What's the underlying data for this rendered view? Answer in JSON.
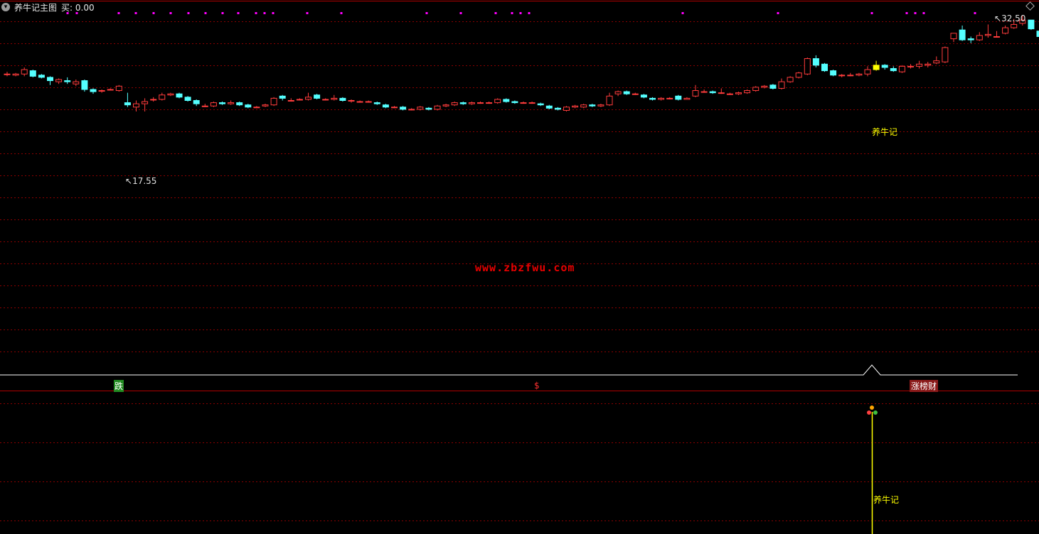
{
  "header": {
    "menu_icon": "chevron-down-icon",
    "title": "养牛记主图",
    "buy_label": "买: 0.00"
  },
  "price_labels": {
    "high": "32.50",
    "low": "17.55",
    "signal": "养牛记"
  },
  "watermark": "www.zbzfwu.com",
  "strip_labels": {
    "left": "跌",
    "mid": "$",
    "right": "涨榜财"
  },
  "lower_pane": {
    "signal_label": "养牛记"
  },
  "colors": {
    "background": "#000000",
    "up": "#ff3c3c",
    "down": "#54ffff",
    "grid": "#8b0000",
    "marker": "#ff00ff",
    "signal": "#ffff00",
    "strip_line": "#ffffff"
  },
  "chart_data": {
    "type": "candlestick",
    "y_high": 32.5,
    "y_low": 17.55,
    "candles": [
      [
        27.2,
        27.2,
        27.4,
        27.0
      ],
      [
        27.1,
        27.2,
        27.3,
        27.0
      ],
      [
        27.2,
        27.6,
        27.8,
        27.0
      ],
      [
        27.5,
        27.0,
        27.6,
        26.9
      ],
      [
        27.1,
        26.9,
        27.2,
        26.8
      ],
      [
        26.9,
        26.6,
        27.0,
        26.2
      ],
      [
        26.5,
        26.7,
        26.8,
        26.3
      ],
      [
        26.6,
        26.5,
        26.9,
        26.3
      ],
      [
        26.3,
        26.5,
        26.7,
        26.1
      ],
      [
        26.6,
        25.8,
        26.7,
        25.6
      ],
      [
        25.8,
        25.6,
        25.9,
        25.4
      ],
      [
        25.7,
        25.7,
        25.8,
        25.5
      ],
      [
        25.8,
        25.8,
        25.9,
        25.7
      ],
      [
        25.7,
        26.1,
        26.2,
        25.6
      ],
      [
        24.6,
        24.4,
        25.5,
        24.2
      ],
      [
        24.2,
        24.5,
        24.8,
        23.8
      ],
      [
        24.5,
        24.7,
        25.0,
        23.8
      ],
      [
        24.9,
        24.9,
        25.1,
        24.7
      ],
      [
        24.9,
        25.3,
        25.5,
        24.8
      ],
      [
        25.3,
        25.4,
        25.5,
        25.2
      ],
      [
        25.4,
        25.1,
        25.5,
        25.0
      ],
      [
        25.1,
        24.8,
        25.2,
        24.7
      ],
      [
        24.8,
        24.5,
        24.9,
        24.3
      ],
      [
        24.3,
        24.3,
        24.5,
        24.2
      ],
      [
        24.3,
        24.6,
        24.7,
        24.2
      ],
      [
        24.6,
        24.5,
        24.7,
        24.4
      ],
      [
        24.5,
        24.6,
        24.8,
        24.4
      ],
      [
        24.6,
        24.4,
        24.7,
        24.3
      ],
      [
        24.4,
        24.2,
        24.5,
        24.1
      ],
      [
        24.2,
        24.2,
        24.3,
        24.1
      ],
      [
        24.3,
        24.4,
        24.5,
        24.2
      ],
      [
        24.4,
        25.0,
        25.1,
        24.3
      ],
      [
        25.2,
        25.0,
        25.3,
        24.8
      ],
      [
        24.8,
        24.8,
        25.0,
        24.7
      ],
      [
        24.9,
        24.9,
        25.0,
        24.8
      ],
      [
        24.9,
        25.1,
        25.5,
        24.8
      ],
      [
        25.3,
        25.0,
        25.4,
        24.9
      ],
      [
        24.9,
        24.9,
        25.0,
        24.8
      ],
      [
        24.9,
        25.0,
        25.3,
        24.8
      ],
      [
        25.0,
        24.8,
        25.1,
        24.7
      ],
      [
        24.8,
        24.8,
        24.9,
        24.6
      ],
      [
        24.7,
        24.7,
        24.8,
        24.6
      ],
      [
        24.7,
        24.7,
        24.8,
        24.6
      ],
      [
        24.6,
        24.5,
        24.7,
        24.4
      ],
      [
        24.4,
        24.2,
        24.5,
        24.1
      ],
      [
        24.2,
        24.2,
        24.3,
        24.1
      ],
      [
        24.2,
        24.0,
        24.3,
        23.9
      ],
      [
        24.0,
        24.0,
        24.1,
        23.9
      ],
      [
        24.0,
        24.2,
        24.3,
        23.9
      ],
      [
        24.1,
        24.0,
        24.2,
        23.9
      ],
      [
        24.0,
        24.3,
        24.4,
        23.9
      ],
      [
        24.3,
        24.4,
        24.5,
        24.2
      ],
      [
        24.4,
        24.6,
        24.7,
        24.3
      ],
      [
        24.6,
        24.5,
        24.7,
        24.4
      ],
      [
        24.5,
        24.6,
        24.7,
        24.4
      ],
      [
        24.6,
        24.6,
        24.7,
        24.5
      ],
      [
        24.6,
        24.6,
        24.7,
        24.5
      ],
      [
        24.6,
        24.9,
        25.0,
        24.5
      ],
      [
        24.9,
        24.7,
        25.0,
        24.6
      ],
      [
        24.7,
        24.6,
        24.8,
        24.5
      ],
      [
        24.6,
        24.6,
        24.7,
        24.5
      ],
      [
        24.6,
        24.6,
        24.7,
        24.5
      ],
      [
        24.5,
        24.4,
        24.6,
        24.3
      ],
      [
        24.3,
        24.1,
        24.4,
        24.0
      ],
      [
        24.1,
        24.0,
        24.2,
        23.9
      ],
      [
        23.9,
        24.2,
        24.3,
        23.8
      ],
      [
        24.2,
        24.3,
        24.4,
        24.1
      ],
      [
        24.2,
        24.4,
        24.5,
        24.1
      ],
      [
        24.4,
        24.3,
        24.5,
        24.2
      ],
      [
        24.3,
        24.4,
        24.5,
        24.2
      ],
      [
        24.4,
        25.2,
        25.5,
        24.3
      ],
      [
        25.4,
        25.6,
        25.7,
        25.2
      ],
      [
        25.6,
        25.4,
        25.7,
        25.3
      ],
      [
        25.4,
        25.4,
        25.5,
        25.3
      ],
      [
        25.3,
        25.1,
        25.4,
        25.0
      ],
      [
        25.0,
        24.9,
        25.1,
        24.8
      ],
      [
        24.9,
        25.0,
        25.1,
        24.8
      ],
      [
        25.0,
        25.0,
        25.1,
        24.9
      ],
      [
        25.2,
        24.9,
        25.3,
        24.8
      ],
      [
        24.9,
        25.0,
        25.1,
        24.9
      ],
      [
        25.2,
        25.7,
        26.2,
        25.1
      ],
      [
        25.6,
        25.6,
        25.8,
        25.5
      ],
      [
        25.6,
        25.5,
        25.7,
        25.4
      ],
      [
        25.5,
        25.5,
        25.9,
        25.4
      ],
      [
        25.4,
        25.4,
        25.5,
        25.3
      ],
      [
        25.4,
        25.5,
        25.6,
        25.3
      ],
      [
        25.5,
        25.7,
        25.8,
        25.4
      ],
      [
        25.7,
        26.0,
        26.1,
        25.6
      ],
      [
        26.0,
        26.1,
        26.2,
        25.9
      ],
      [
        26.2,
        25.9,
        26.3,
        25.8
      ],
      [
        25.9,
        26.5,
        26.8,
        25.8
      ],
      [
        26.5,
        26.9,
        27.0,
        26.4
      ],
      [
        26.9,
        27.3,
        27.4,
        26.8
      ],
      [
        27.2,
        28.6,
        28.7,
        27.1
      ],
      [
        28.6,
        28.0,
        28.9,
        27.8
      ],
      [
        28.1,
        27.5,
        28.2,
        27.4
      ],
      [
        27.5,
        27.1,
        27.6,
        27.0
      ],
      [
        27.1,
        27.1,
        27.2,
        26.9
      ],
      [
        27.1,
        27.1,
        27.3,
        27.0
      ],
      [
        27.1,
        27.2,
        27.3,
        27.0
      ],
      [
        27.2,
        27.6,
        27.9,
        27.0
      ],
      [
        27.6,
        28.0,
        28.4,
        27.5
      ],
      [
        28.0,
        27.8,
        28.1,
        27.6
      ],
      [
        27.7,
        27.5,
        27.9,
        27.4
      ],
      [
        27.4,
        27.9,
        28.0,
        27.3
      ],
      [
        27.9,
        27.9,
        28.1,
        27.7
      ],
      [
        27.9,
        28.1,
        28.4,
        27.7
      ],
      [
        28.0,
        28.1,
        28.3,
        27.8
      ],
      [
        28.2,
        28.4,
        28.8,
        28.1
      ],
      [
        28.3,
        29.6,
        29.7,
        28.2
      ],
      [
        30.4,
        30.9,
        30.9,
        30.1
      ],
      [
        31.2,
        30.3,
        31.6,
        30.2
      ],
      [
        30.4,
        30.3,
        30.6,
        30.0
      ],
      [
        30.3,
        30.7,
        31.0,
        30.2
      ],
      [
        30.7,
        30.8,
        31.7,
        30.5
      ],
      [
        30.6,
        30.6,
        31.1,
        30.5
      ],
      [
        30.9,
        31.4,
        31.6,
        30.8
      ],
      [
        31.4,
        31.7,
        32.2,
        31.3
      ],
      [
        31.8,
        32.1,
        32.5,
        31.6
      ],
      [
        32.1,
        31.3,
        32.1,
        31.2
      ],
      [
        31.1,
        30.6,
        31.1,
        30.5
      ],
      [
        30.6,
        30.2,
        30.6,
        29.9
      ],
      [
        30.3,
        30.6,
        30.7,
        30.2
      ]
    ],
    "signal_candle_index": 101
  }
}
